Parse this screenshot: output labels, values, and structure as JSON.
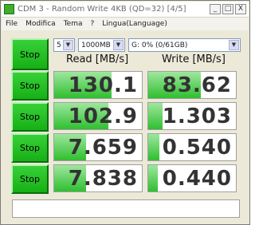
{
  "window": {
    "title": "CDM 3 - Random Write 4KB (QD=32) [4/5]",
    "minimize": "_",
    "restore": "□",
    "close": "X"
  },
  "menu": [
    "File",
    "Modifica",
    "Tema",
    "?",
    "Lingua(Language)"
  ],
  "controls": {
    "count": "5",
    "size": "1000MB",
    "drive": "G: 0% (0/61GB)"
  },
  "headers": {
    "read": "Read [MB/s]",
    "write": "Write [MB/s]"
  },
  "stop_label": "Stop",
  "rows": [
    {
      "read": "130.1",
      "write": "83.62"
    },
    {
      "read": "102.9",
      "write": "1.303"
    },
    {
      "read": "7.659",
      "write": "0.540"
    },
    {
      "read": "7.838",
      "write": "0.440"
    }
  ],
  "comment": "",
  "colors": {
    "accent": "#2fbf2f",
    "stop_button": "#16b016"
  }
}
